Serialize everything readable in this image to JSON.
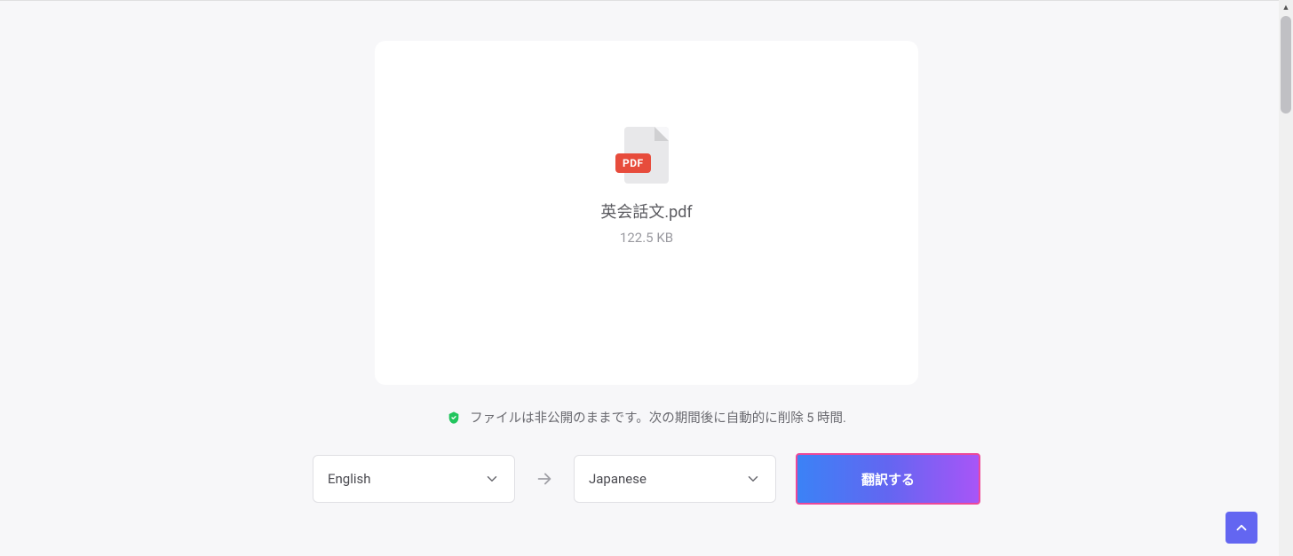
{
  "file": {
    "badge": "PDF",
    "name": "英会話文.pdf",
    "size": "122.5 KB"
  },
  "privacy": {
    "text": "ファイルは非公開のままです。次の期間後に自動的に削除 5 時間."
  },
  "languages": {
    "source": "English",
    "target": "Japanese"
  },
  "actions": {
    "translate": "翻訳する"
  }
}
